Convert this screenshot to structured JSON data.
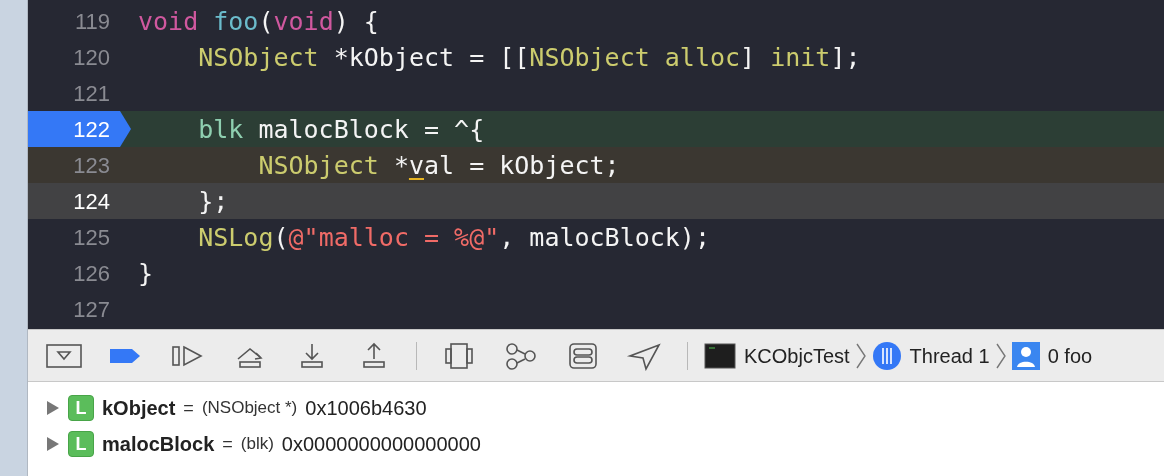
{
  "editor": {
    "lines": [
      {
        "number": "119",
        "executing": false,
        "highlighted": false,
        "cursor": false,
        "breakpoint": false,
        "tokens": [
          {
            "text": "void",
            "kind": "keyword"
          },
          {
            "text": " foo",
            "kind": "function"
          },
          {
            "text": "(",
            "kind": "plain"
          },
          {
            "text": "void",
            "kind": "keyword"
          },
          {
            "text": ") {",
            "kind": "plain"
          }
        ]
      },
      {
        "number": "120",
        "executing": false,
        "highlighted": false,
        "cursor": false,
        "breakpoint": false,
        "tokens": [
          {
            "text": "    NSObject",
            "kind": "type"
          },
          {
            "text": " *kObject = [[",
            "kind": "plain"
          },
          {
            "text": "NSObject alloc",
            "kind": "type"
          },
          {
            "text": "] ",
            "kind": "plain"
          },
          {
            "text": "init",
            "kind": "type"
          },
          {
            "text": "];",
            "kind": "plain"
          }
        ]
      },
      {
        "number": "121",
        "executing": false,
        "highlighted": false,
        "cursor": false,
        "breakpoint": false
      },
      {
        "number": "122",
        "executing": true,
        "highlighted": false,
        "cursor": false,
        "breakpoint": true,
        "tokens": [
          {
            "text": "    blk",
            "kind": "block_type"
          },
          {
            "text": " malocBlock = ^{",
            "kind": "plain"
          }
        ]
      },
      {
        "number": "123",
        "executing": false,
        "highlighted": true,
        "cursor": false,
        "breakpoint": false,
        "tokens": [
          {
            "text": "        NSObject",
            "kind": "type"
          },
          {
            "text": " *",
            "kind": "plain"
          },
          {
            "text": "v",
            "kind": "plain",
            "warning": true
          },
          {
            "text": "al = kObject;",
            "kind": "plain"
          }
        ]
      },
      {
        "number": "124",
        "executing": false,
        "highlighted": false,
        "cursor": true,
        "breakpoint": false,
        "tokens": [
          {
            "text": "    };",
            "kind": "plain"
          }
        ]
      },
      {
        "number": "125",
        "executing": false,
        "highlighted": false,
        "cursor": false,
        "breakpoint": false,
        "tokens": [
          {
            "text": "    NSLog",
            "kind": "type"
          },
          {
            "text": "(",
            "kind": "plain"
          },
          {
            "text": "@\"malloc = %@\"",
            "kind": "string"
          },
          {
            "text": ", malocBlock);",
            "kind": "plain"
          }
        ]
      },
      {
        "number": "126",
        "executing": false,
        "highlighted": false,
        "cursor": false,
        "breakpoint": false,
        "tokens": [
          {
            "text": "}",
            "kind": "plain"
          }
        ]
      },
      {
        "number": "127",
        "executing": false,
        "highlighted": false,
        "cursor": false,
        "breakpoint": false
      }
    ]
  },
  "debug_bar": {
    "breakpoints_active": true,
    "path": [
      {
        "label": "KCObjcTest",
        "kind": "process"
      },
      {
        "label": "Thread 1",
        "kind": "thread"
      },
      {
        "label": "0 foo",
        "kind": "frame"
      }
    ]
  },
  "variables": [
    {
      "badge": "L",
      "name": "kObject",
      "equals": "=",
      "type": "(NSObject *)",
      "value": "0x1006b4630",
      "expanded": false
    },
    {
      "badge": "L",
      "name": "malocBlock",
      "equals": "=",
      "type": "(blk)",
      "value": "0x0000000000000000",
      "expanded": false
    }
  ]
}
